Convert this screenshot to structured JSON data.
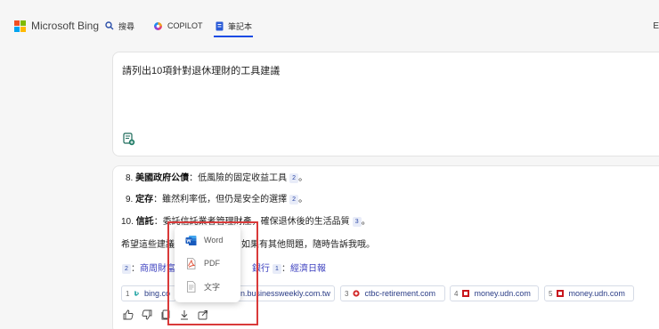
{
  "header": {
    "logo_text": "Microsoft Bing",
    "tabs": [
      {
        "label": "搜尋",
        "icon": "search-icon"
      },
      {
        "label": "COPILOT",
        "icon": "copilot-icon"
      },
      {
        "label": "筆記本",
        "icon": "notebook-icon",
        "active": true
      }
    ],
    "right_text": "E"
  },
  "prompt": {
    "text": "請列出10項針對退休理財的工具建議",
    "icon": "new-note-icon"
  },
  "answer": {
    "items": [
      {
        "num": "8.",
        "term": "美國政府公債",
        "sep": "：",
        "text": "低風險的固定收益工具",
        "cite": "2",
        "end": "。"
      },
      {
        "num": "9.",
        "term": "定存",
        "sep": "：",
        "text": "雖然利率低，但仍是安全的選擇",
        "cite": "2",
        "end": "。"
      },
      {
        "num": "10.",
        "term": "信託",
        "sep": "：",
        "text": "委託信託業者管理財產，確保退休後的生活品質",
        "cite": "3",
        "end": "。"
      }
    ],
    "closing_left": "希望這些建議",
    "closing_right": "如果有其他問題，隨時告訴我哦。",
    "learn_more": [
      {
        "num": "2",
        "text": "商周財富"
      },
      {
        "num": "",
        "text": "銀行"
      },
      {
        "num": "1",
        "text": "經濟日報"
      }
    ],
    "sources": [
      {
        "num": "1",
        "text": "bing.co",
        "icon": "bing-favicon"
      },
      {
        "num": "",
        "text": "n.businessweekly.com.tw",
        "icon": ""
      },
      {
        "num": "3",
        "text": "ctbc-retirement.com",
        "icon": "ctbc-favicon"
      },
      {
        "num": "4",
        "text": "money.udn.com",
        "icon": "udn-favicon"
      },
      {
        "num": "5",
        "text": "money.udn.com",
        "icon": "udn-favicon"
      }
    ],
    "actions": [
      "thumbs-up-icon",
      "thumbs-down-icon",
      "copy-icon",
      "download-icon",
      "share-icon"
    ]
  },
  "export_menu": {
    "items": [
      {
        "label": "Word",
        "icon": "word-icon"
      },
      {
        "label": "PDF",
        "icon": "pdf-icon"
      },
      {
        "label": "文字",
        "icon": "text-file-icon"
      }
    ]
  },
  "colors": {
    "accent": "#174ae4",
    "highlight_box": "#d93a3a",
    "link": "#3b3fbf"
  }
}
